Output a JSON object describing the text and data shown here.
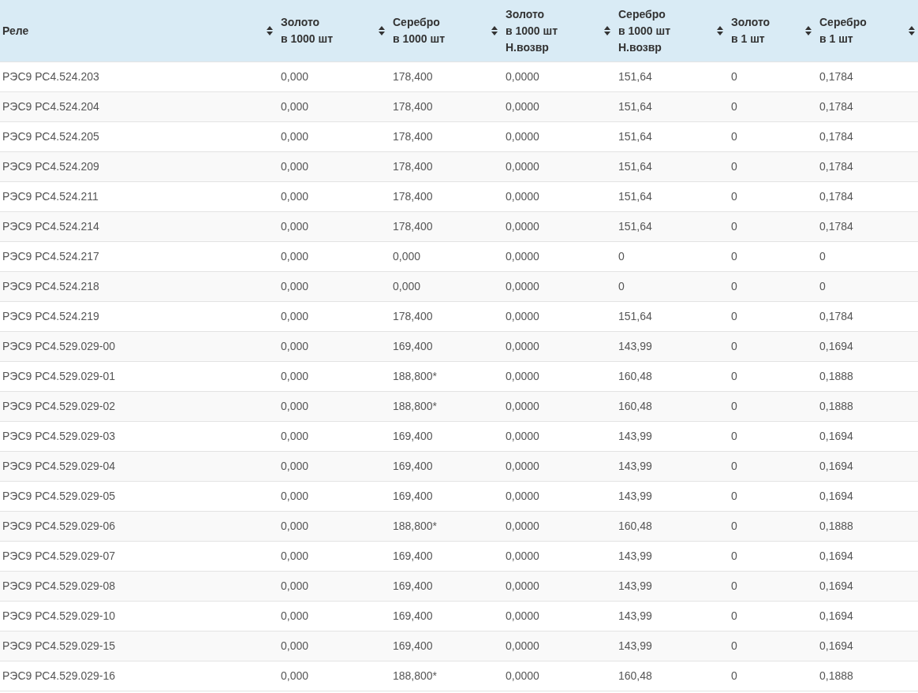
{
  "table": {
    "columns": [
      {
        "lines": [
          "Реле"
        ]
      },
      {
        "lines": [
          "Золото",
          "в 1000 шт"
        ]
      },
      {
        "lines": [
          "Серебро",
          "в 1000 шт"
        ]
      },
      {
        "lines": [
          "Золото",
          "в 1000 шт",
          "Н.возвр"
        ]
      },
      {
        "lines": [
          "Серебро",
          "в 1000 шт",
          "Н.возвр"
        ]
      },
      {
        "lines": [
          "Золото",
          "в 1 шт"
        ]
      },
      {
        "lines": [
          "Серебро",
          "в 1 шт"
        ]
      }
    ],
    "rows": [
      [
        "РЭС9 РС4.524.203",
        "0,000",
        "178,400",
        "0,0000",
        "151,64",
        "0",
        "0,1784"
      ],
      [
        "РЭС9 РС4.524.204",
        "0,000",
        "178,400",
        "0,0000",
        "151,64",
        "0",
        "0,1784"
      ],
      [
        "РЭС9 РС4.524.205",
        "0,000",
        "178,400",
        "0,0000",
        "151,64",
        "0",
        "0,1784"
      ],
      [
        "РЭС9 РС4.524.209",
        "0,000",
        "178,400",
        "0,0000",
        "151,64",
        "0",
        "0,1784"
      ],
      [
        "РЭС9 РС4.524.211",
        "0,000",
        "178,400",
        "0,0000",
        "151,64",
        "0",
        "0,1784"
      ],
      [
        "РЭС9 РС4.524.214",
        "0,000",
        "178,400",
        "0,0000",
        "151,64",
        "0",
        "0,1784"
      ],
      [
        "РЭС9 РС4.524.217",
        "0,000",
        "0,000",
        "0,0000",
        "0",
        "0",
        "0"
      ],
      [
        "РЭС9 РС4.524.218",
        "0,000",
        "0,000",
        "0,0000",
        "0",
        "0",
        "0"
      ],
      [
        "РЭС9 РС4.524.219",
        "0,000",
        "178,400",
        "0,0000",
        "151,64",
        "0",
        "0,1784"
      ],
      [
        "РЭС9 РС4.529.029-00",
        "0,000",
        "169,400",
        "0,0000",
        "143,99",
        "0",
        "0,1694"
      ],
      [
        "РЭС9 РС4.529.029-01",
        "0,000",
        "188,800*",
        "0,0000",
        "160,48",
        "0",
        "0,1888"
      ],
      [
        "РЭС9 РС4.529.029-02",
        "0,000",
        "188,800*",
        "0,0000",
        "160,48",
        "0",
        "0,1888"
      ],
      [
        "РЭС9 РС4.529.029-03",
        "0,000",
        "169,400",
        "0,0000",
        "143,99",
        "0",
        "0,1694"
      ],
      [
        "РЭС9 РС4.529.029-04",
        "0,000",
        "169,400",
        "0,0000",
        "143,99",
        "0",
        "0,1694"
      ],
      [
        "РЭС9 РС4.529.029-05",
        "0,000",
        "169,400",
        "0,0000",
        "143,99",
        "0",
        "0,1694"
      ],
      [
        "РЭС9 РС4.529.029-06",
        "0,000",
        "188,800*",
        "0,0000",
        "160,48",
        "0",
        "0,1888"
      ],
      [
        "РЭС9 РС4.529.029-07",
        "0,000",
        "169,400",
        "0,0000",
        "143,99",
        "0",
        "0,1694"
      ],
      [
        "РЭС9 РС4.529.029-08",
        "0,000",
        "169,400",
        "0,0000",
        "143,99",
        "0",
        "0,1694"
      ],
      [
        "РЭС9 РС4.529.029-10",
        "0,000",
        "169,400",
        "0,0000",
        "143,99",
        "0",
        "0,1694"
      ],
      [
        "РЭС9 РС4.529.029-15",
        "0,000",
        "169,400",
        "0,0000",
        "143,99",
        "0",
        "0,1694"
      ],
      [
        "РЭС9 РС4.529.029-16",
        "0,000",
        "188,800*",
        "0,0000",
        "160,48",
        "0",
        "0,1888"
      ]
    ]
  }
}
